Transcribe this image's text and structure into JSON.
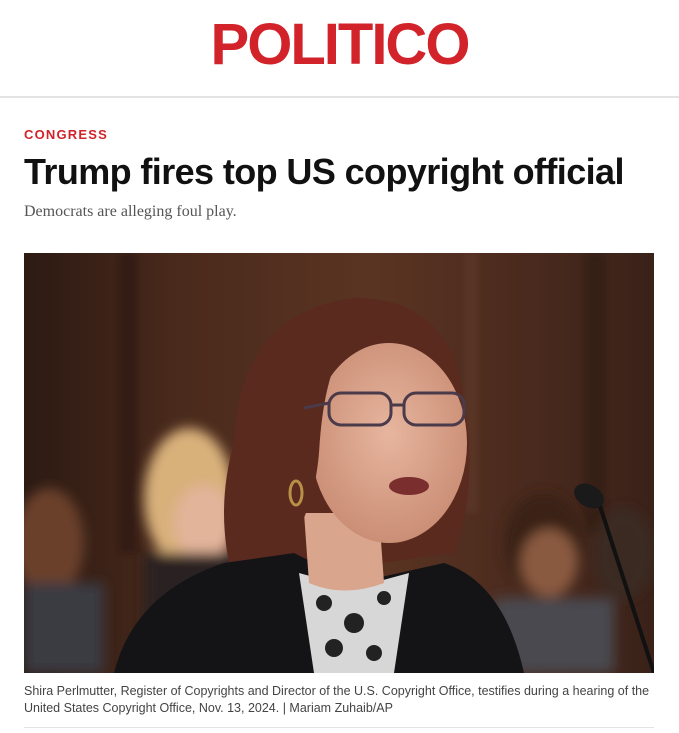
{
  "site": {
    "logo_text": "POLITICO",
    "brand_color": "#D2232A"
  },
  "article": {
    "section": "CONGRESS",
    "headline": "Trump fires top US copyright official",
    "dek": "Democrats are alleging foul play.",
    "photo_caption": "Shira Perlmutter, Register of Copyrights and Director of the U.S. Copyright Office, testifies during a hearing of the United States Copyright Office, Nov. 13, 2024. | Mariam Zuhaib/AP"
  }
}
